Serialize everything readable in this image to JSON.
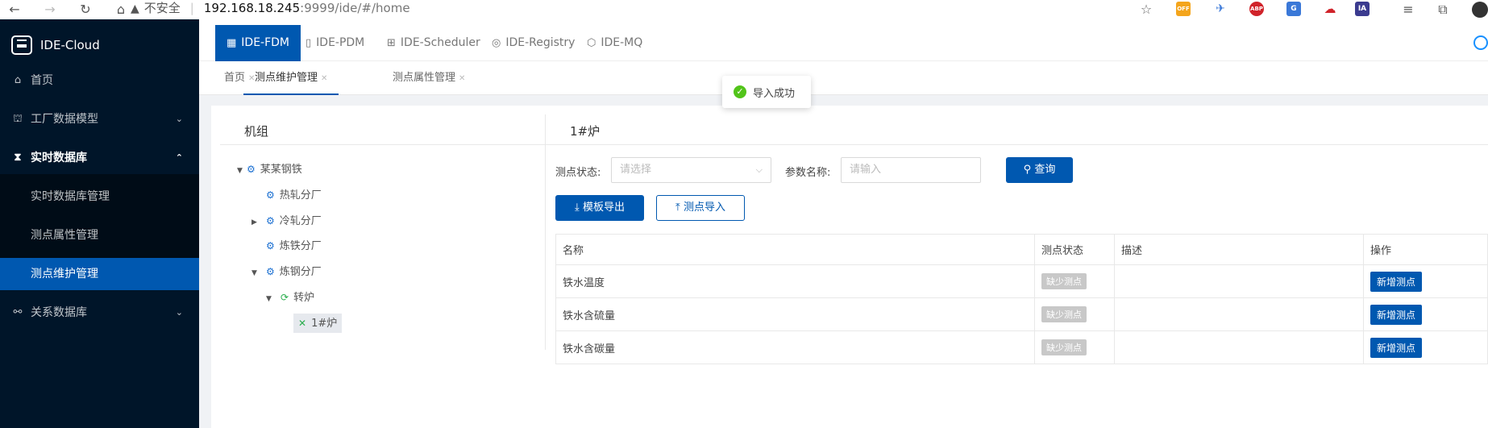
{
  "browser": {
    "insecure": "不安全",
    "sep": "|",
    "url_host": "192.168.18.245",
    "url_path": ":9999/ide/#/home",
    "ext_off": "OFF",
    "ext_abp": "ABP",
    "ext_ia": "IA"
  },
  "sidebar": {
    "brand": "IDE-Cloud",
    "items": [
      {
        "label": "首页"
      },
      {
        "label": "工厂数据模型"
      },
      {
        "label": "实时数据库"
      },
      {
        "label": "实时数据库管理"
      },
      {
        "label": "测点属性管理"
      },
      {
        "label": "测点维护管理"
      },
      {
        "label": "关系数据库"
      }
    ]
  },
  "topnav": {
    "tabs": [
      {
        "label": "IDE-FDM"
      },
      {
        "label": "IDE-PDM"
      },
      {
        "label": "IDE-Scheduler"
      },
      {
        "label": "IDE-Registry"
      },
      {
        "label": "IDE-MQ"
      }
    ]
  },
  "pagetabs": [
    {
      "label": "首页"
    },
    {
      "label": "测点维护管理"
    },
    {
      "label": "测点属性管理"
    }
  ],
  "toast": {
    "text": "导入成功"
  },
  "tree": {
    "title": "机组",
    "nodes": [
      {
        "label": "某某钢铁"
      },
      {
        "label": "热轧分厂"
      },
      {
        "label": "冷轧分厂"
      },
      {
        "label": "炼铁分厂"
      },
      {
        "label": "炼钢分厂"
      },
      {
        "label": "转炉"
      },
      {
        "label": "1#炉"
      }
    ]
  },
  "detail": {
    "title": "1#炉",
    "status_label": "测点状态:",
    "status_placeholder": "请选择",
    "param_label": "参数名称:",
    "param_placeholder": "请输入",
    "query_btn": "查询",
    "export_btn": "模板导出",
    "import_btn": "测点导入"
  },
  "table": {
    "headers": [
      "名称",
      "测点状态",
      "描述",
      "操作"
    ],
    "rows": [
      {
        "name": "铁水温度",
        "status": "缺少测点",
        "desc": "",
        "action": "新增测点"
      },
      {
        "name": "铁水含硫量",
        "status": "缺少测点",
        "desc": "",
        "action": "新增测点"
      },
      {
        "name": "铁水含碳量",
        "status": "缺少测点",
        "desc": "",
        "action": "新增测点"
      }
    ]
  }
}
